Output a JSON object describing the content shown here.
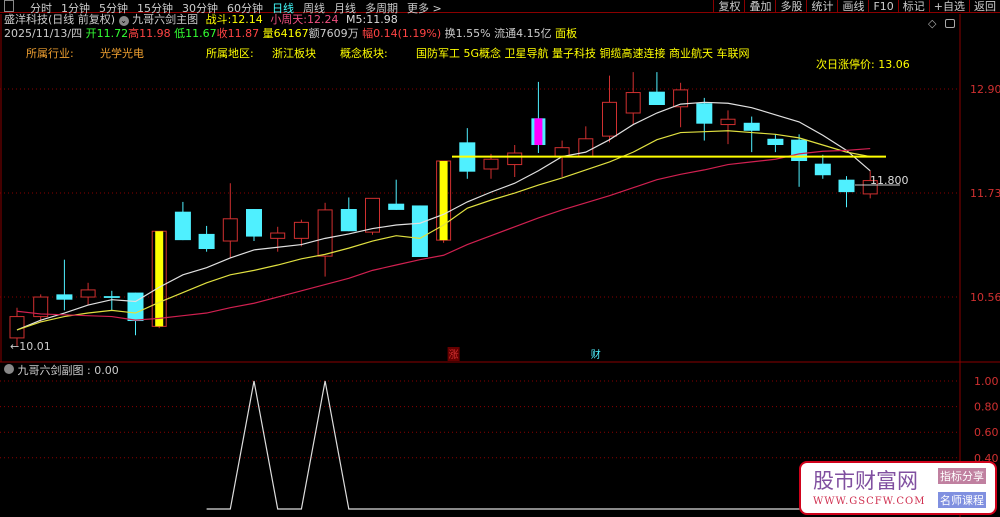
{
  "toolbar": {
    "tabs": [
      "分时",
      "1分钟",
      "5分钟",
      "15分钟",
      "30分钟",
      "60分钟",
      "日线",
      "周线",
      "月线",
      "多周期",
      "更多 >"
    ],
    "active": "日线",
    "buttons": [
      "复权",
      "叠加",
      "多股",
      "统计",
      "画线",
      "F10",
      "标记",
      "+自选",
      "返回"
    ]
  },
  "header": {
    "stock": "盛洋科技(日线 前复权)",
    "indicator": "九哥六剑主图",
    "zhandou_label": "战斗:",
    "zhandou": "12.14",
    "xiaozhoutian_label": "小周天:",
    "xiaozhoutian": "12.24",
    "ma5_label": "M5:",
    "ma5": "11.98"
  },
  "quote": {
    "date": "2025/11/13/四",
    "open": "开11.72",
    "high": "高11.98",
    "low": "低11.67",
    "close": "收11.87",
    "vol": "量64167",
    "amount": "额7609万",
    "change": "幅0.14(1.19%)",
    "turnover": "换1.55%",
    "float": "流通4.15亿",
    "panel": "面板"
  },
  "info": {
    "industry_label": "所属行业:",
    "industry": "光学光电",
    "region_label": "所属地区:",
    "region": "浙江板块",
    "concept_label": "概念板块:",
    "concepts": "国防军工 5G概念 卫星导航 量子科技 铜缆高速连接 商业航天 车联网",
    "limit_label": "次日涨停价:",
    "limit": "13.06"
  },
  "colors": {
    "up": "#d03030",
    "down": "#4ff0ff",
    "limit_up": "#ffff00",
    "special": "#ff00ff",
    "ma5": "#e0e0e0",
    "ma10": "#e0e040",
    "ma20": "#d02050",
    "grid": "#8a0000"
  },
  "chart_data": [
    {
      "type": "candlestick",
      "y_ticks": [
        "12.90",
        "11.73",
        "10.56"
      ],
      "ylim": [
        10.0,
        13.2
      ],
      "candles": [
        [
          10.1,
          10.44,
          10.01,
          10.34,
          ""
        ],
        [
          10.34,
          10.59,
          10.28,
          10.56,
          ""
        ],
        [
          10.59,
          10.98,
          10.41,
          10.53,
          ""
        ],
        [
          10.56,
          10.72,
          10.47,
          10.64,
          ""
        ],
        [
          10.57,
          10.63,
          10.41,
          10.55,
          ""
        ],
        [
          10.61,
          10.61,
          10.13,
          10.29,
          ""
        ],
        [
          10.23,
          11.3,
          10.21,
          11.3,
          "limit"
        ],
        [
          11.52,
          11.63,
          11.2,
          11.2,
          ""
        ],
        [
          11.27,
          11.36,
          11.07,
          11.1,
          ""
        ],
        [
          11.19,
          11.84,
          11.0,
          11.44,
          ""
        ],
        [
          11.55,
          11.55,
          11.19,
          11.24,
          ""
        ],
        [
          11.22,
          11.35,
          11.07,
          11.28,
          ""
        ],
        [
          11.22,
          11.43,
          11.13,
          11.4,
          ""
        ],
        [
          11.02,
          11.62,
          10.79,
          11.54,
          ""
        ],
        [
          11.55,
          11.68,
          11.3,
          11.3,
          ""
        ],
        [
          11.29,
          11.67,
          11.26,
          11.67,
          ""
        ],
        [
          11.61,
          11.88,
          11.54,
          11.54,
          ""
        ],
        [
          11.59,
          11.59,
          11.01,
          11.01,
          ""
        ],
        [
          11.2,
          12.09,
          11.17,
          12.09,
          "limit"
        ],
        [
          12.3,
          12.46,
          11.89,
          11.97,
          ""
        ],
        [
          12.0,
          12.17,
          11.89,
          12.11,
          ""
        ],
        [
          12.05,
          12.27,
          11.91,
          12.18,
          ""
        ],
        [
          12.57,
          12.98,
          12.18,
          12.27,
          "special"
        ],
        [
          12.14,
          12.32,
          11.91,
          12.24,
          ""
        ],
        [
          12.14,
          12.48,
          12.14,
          12.34,
          ""
        ],
        [
          12.37,
          13.05,
          12.3,
          12.75,
          ""
        ],
        [
          12.63,
          13.09,
          12.5,
          12.86,
          ""
        ],
        [
          12.87,
          13.09,
          12.72,
          12.72,
          ""
        ],
        [
          12.7,
          12.97,
          12.47,
          12.89,
          ""
        ],
        [
          12.74,
          12.8,
          12.32,
          12.51,
          ""
        ],
        [
          12.5,
          12.66,
          12.28,
          12.56,
          ""
        ],
        [
          12.52,
          12.59,
          12.19,
          12.43,
          ""
        ],
        [
          12.34,
          12.39,
          12.19,
          12.27,
          ""
        ],
        [
          12.33,
          12.39,
          11.8,
          12.09,
          ""
        ],
        [
          12.06,
          12.16,
          11.89,
          11.93,
          ""
        ],
        [
          11.88,
          11.92,
          11.57,
          11.74,
          ""
        ],
        [
          11.72,
          11.98,
          11.67,
          11.87,
          ""
        ]
      ],
      "ma5": [
        10.19,
        10.3,
        10.38,
        10.47,
        10.53,
        10.51,
        10.67,
        10.81,
        10.89,
        11.0,
        11.09,
        11.12,
        11.15,
        11.22,
        11.27,
        11.33,
        11.37,
        11.39,
        11.49,
        11.63,
        11.74,
        11.84,
        11.98,
        12.14,
        12.19,
        12.33,
        12.5,
        12.63,
        12.73,
        12.75,
        12.74,
        12.69,
        12.61,
        12.53,
        12.38,
        12.21,
        11.98
      ],
      "ma10": [
        10.19,
        10.28,
        10.34,
        10.38,
        10.41,
        10.38,
        10.5,
        10.61,
        10.72,
        10.81,
        10.86,
        10.92,
        10.99,
        11.04,
        11.11,
        11.19,
        11.25,
        11.22,
        11.37,
        11.56,
        11.65,
        11.73,
        11.82,
        11.9,
        11.99,
        12.08,
        12.19,
        12.33,
        12.41,
        12.42,
        12.43,
        12.41,
        12.39,
        12.35,
        12.27,
        12.19,
        12.14
      ],
      "ma20": [
        10.4,
        10.37,
        10.36,
        10.35,
        10.34,
        10.3,
        10.32,
        10.35,
        10.38,
        10.44,
        10.49,
        10.56,
        10.63,
        10.7,
        10.77,
        10.86,
        10.92,
        10.98,
        11.03,
        11.15,
        11.25,
        11.35,
        11.45,
        11.54,
        11.62,
        11.7,
        11.79,
        11.88,
        11.94,
        11.99,
        12.05,
        12.08,
        12.11,
        12.17,
        12.2,
        12.21,
        12.23
      ],
      "support_line": 12.14,
      "low_label": "10.01",
      "price_label": "11.800",
      "markers": [
        {
          "candle": 18,
          "text": "涨",
          "color": "#d03030"
        },
        {
          "candle": 24,
          "text": "财",
          "color": "#4ff0ff"
        }
      ]
    },
    {
      "type": "line",
      "title": "九哥六剑副图",
      "value": "0.00",
      "y_ticks": [
        "1.00",
        "0.80",
        "0.60",
        "0.40"
      ],
      "ylim": [
        0,
        1
      ],
      "first_candle": 8,
      "values": [
        0,
        0,
        1,
        0,
        0,
        1,
        0,
        0,
        0,
        0,
        0,
        0,
        0,
        0,
        0,
        0,
        0,
        0,
        0,
        0,
        0,
        0,
        0,
        0,
        0,
        0,
        0,
        0,
        0,
        0,
        0
      ]
    }
  ],
  "watermark": {
    "name": "股市财富网",
    "url": "WWW.GSCFW.COM",
    "tag1": "指标分享",
    "tag2": "名师课程"
  }
}
